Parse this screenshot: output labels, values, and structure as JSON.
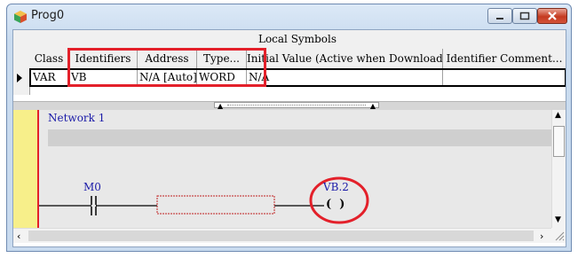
{
  "window": {
    "title": "Prog0"
  },
  "symbols": {
    "group_header": "Local Symbols",
    "columns": [
      "Class",
      "Identifiers",
      "Address",
      "Type...",
      "Initial Value (Active when Download)",
      "Identifier Comment..."
    ],
    "row": [
      "VAR",
      "VB",
      "N/A [Auto]",
      "WORD",
      "N/A",
      ""
    ]
  },
  "ladder": {
    "network_label": "Network 1",
    "contact_label": "M0",
    "coil_label": "VB.2",
    "coil_glyph": "(  )"
  },
  "colors": {
    "highlight": "#e3202a",
    "label_blue": "#1a1aa8",
    "rail_yellow": "#f7ef8a"
  },
  "icons": [
    "app-cube-icon",
    "minimize-icon",
    "maximize-icon",
    "close-icon",
    "splitter-up-arrow-icon",
    "scroll-up-icon",
    "scroll-down-icon",
    "scroll-left-icon",
    "scroll-right-icon",
    "resize-grip-icon"
  ]
}
